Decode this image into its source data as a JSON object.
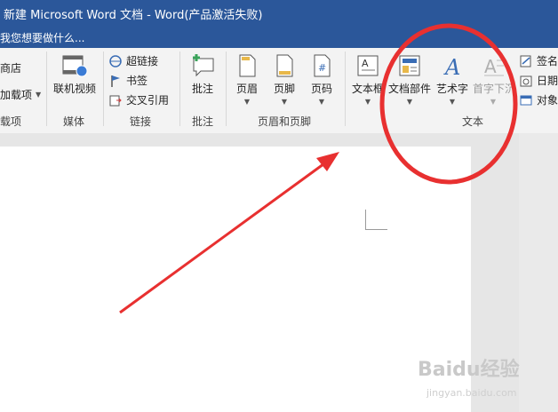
{
  "window": {
    "title": "新建 Microsoft Word 文档 - Word(产品激活失败)"
  },
  "tell_me": {
    "text": "我您想要做什么..."
  },
  "ribbon": {
    "left_partial": {
      "store": "商店",
      "addins": "加载项",
      "group": "载项"
    },
    "media": {
      "online_video": "联机视频",
      "group": "媒体"
    },
    "links": {
      "hyperlink": "超链接",
      "bookmark": "书签",
      "cross_ref": "交叉引用",
      "group": "链接"
    },
    "comments": {
      "comment": "批注",
      "group": "批注"
    },
    "header_footer": {
      "header": "页眉",
      "footer": "页脚",
      "page_number": "页码",
      "group": "页眉和页脚"
    },
    "text": {
      "textbox": "文本框",
      "quick_parts": "文档部件",
      "wordart": "艺术字",
      "dropcap": "首字下沉",
      "group": "文本"
    },
    "right_partial": {
      "signature": "签名",
      "datetime": "日期",
      "object": "对象"
    }
  },
  "watermark": {
    "brand": "Baidu经验",
    "url": "jingyan.baidu.com"
  },
  "annotation": {
    "arrow_color": "#e83030",
    "circle_color": "#e83030"
  }
}
